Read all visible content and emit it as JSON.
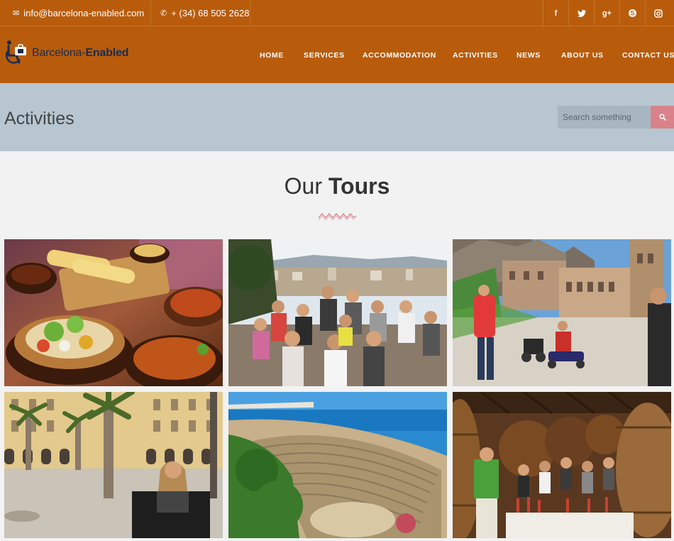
{
  "topbar": {
    "email": "info@barcelona-enabled.com",
    "phone": "+ (34) 68 505 2628",
    "social": [
      {
        "icon": "facebook-icon",
        "glyph": "f"
      },
      {
        "icon": "twitter-icon",
        "glyph": "t"
      },
      {
        "icon": "google-plus-icon",
        "glyph": "g+"
      },
      {
        "icon": "skype-icon",
        "glyph": "S"
      },
      {
        "icon": "instagram-icon",
        "glyph": "◘"
      }
    ]
  },
  "brand": {
    "name_light": "Barcelona-",
    "name_bold": "Enabled"
  },
  "nav": [
    "HOME",
    "SERVICES",
    "ACCOMMODATION",
    "ACTIVITIES",
    "NEWS",
    "ABOUT US",
    "CONTACT US"
  ],
  "page": {
    "title": "Activities",
    "search_placeholder": "Search something"
  },
  "section": {
    "heading_light": "Our ",
    "heading_bold": "Tours"
  },
  "tours": [
    {
      "name": "tour-tapas-food",
      "scene": "food"
    },
    {
      "name": "tour-group-viewpoint",
      "scene": "group"
    },
    {
      "name": "tour-montserrat-monastery",
      "scene": "monastery"
    },
    {
      "name": "tour-placa-reial",
      "scene": "plaza"
    },
    {
      "name": "tour-tarragona-amphitheatre",
      "scene": "amphitheatre"
    },
    {
      "name": "tour-winery-cellar",
      "scene": "winery"
    }
  ],
  "colors": {
    "brand_orange": "#b85c0c",
    "title_band": "#b7c6d1",
    "search_button": "#d9828a",
    "logo_navy": "#1d2b4f"
  }
}
